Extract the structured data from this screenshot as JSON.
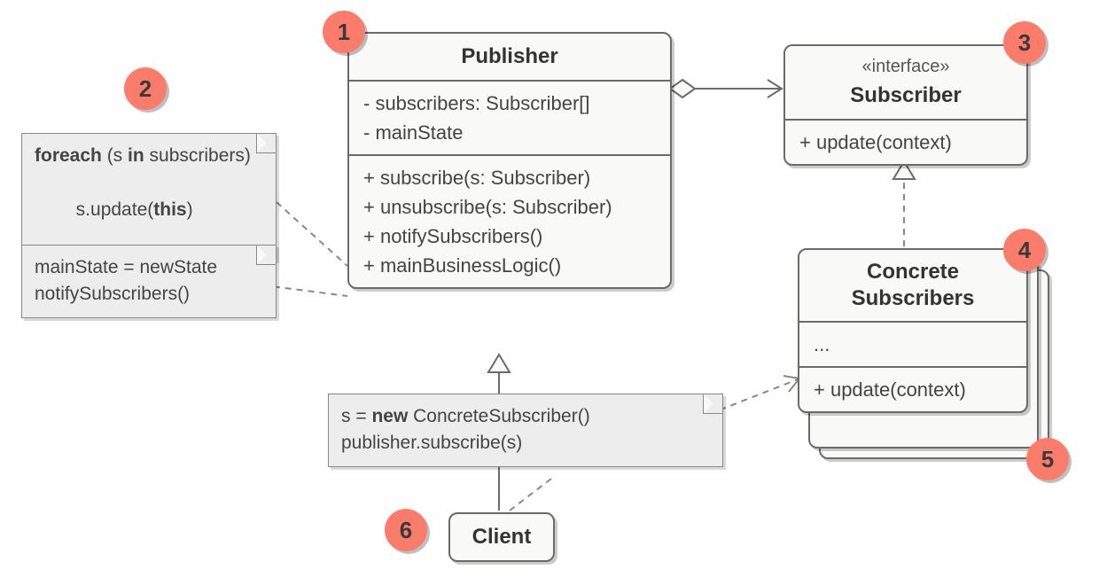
{
  "badges": {
    "b1": "1",
    "b2": "2",
    "b3": "3",
    "b4": "4",
    "b5": "5",
    "b6": "6"
  },
  "publisher": {
    "title": "Publisher",
    "attr1": "- subscribers: Subscriber[]",
    "attr2": "- mainState",
    "op1": "+ subscribe(s: Subscriber)",
    "op2": "+ unsubscribe(s: Subscriber)",
    "op3": "+ notifySubscribers()",
    "op4": "+ mainBusinessLogic()"
  },
  "subscriber_iface": {
    "stereo": "«interface»",
    "title": "Subscriber",
    "op1": "+ update(context)"
  },
  "concrete": {
    "title_line1": "Concrete",
    "title_line2": "Subscribers",
    "body": "...",
    "op1": "+ update(context)"
  },
  "client": {
    "title": "Client"
  },
  "notes": {
    "note_loop_kw_foreach": "foreach",
    "note_loop_paren_open": " (s ",
    "note_loop_kw_in": "in",
    "note_loop_rest": " subscribers)",
    "note_loop_line2a": "  s.update(",
    "note_loop_kw_this": "this",
    "note_loop_line2b": ")",
    "note_state_line1": "mainState = newState",
    "note_state_line2": "notifySubscribers()",
    "note_client_line1a": "s = ",
    "note_client_kw_new": "new",
    "note_client_line1b": " ConcreteSubscriber()",
    "note_client_line2": "publisher.subscribe(s)"
  }
}
